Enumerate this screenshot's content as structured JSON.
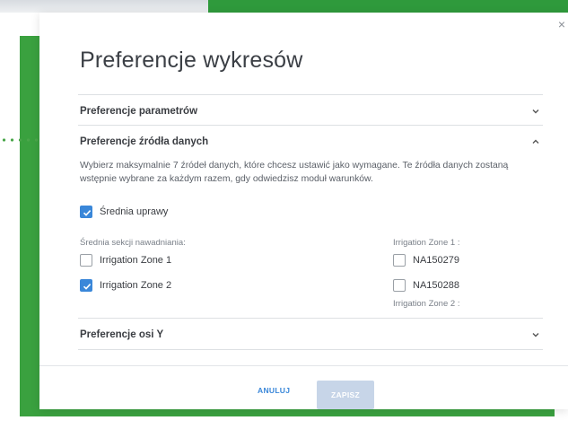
{
  "dialog": {
    "title": "Preferencje wykresów",
    "close_label": "×"
  },
  "sections": [
    {
      "label": "Preferencje parametrów",
      "expanded": false
    },
    {
      "label": "Preferencje źródła danych",
      "expanded": true
    },
    {
      "label": "Preferencje osi Y",
      "expanded": false
    }
  ],
  "data_source": {
    "description": "Wybierz maksymalnie 7 źródeł danych, które chcesz ustawić jako wymagane. Te źródła danych zostaną wstępnie wybrane za każdym razem, gdy odwiedzisz moduł warunków.",
    "crop_average": {
      "label": "Średnia uprawy",
      "checked": true
    },
    "irrigation_avg_heading": "Średnia sekcji nawadniania:",
    "irrigation_avg_items": [
      {
        "label": "Irrigation Zone 1",
        "checked": false
      },
      {
        "label": "Irrigation Zone 2",
        "checked": true
      }
    ],
    "zone1_heading": "Irrigation Zone 1 :",
    "zone1_items": [
      {
        "label": "NA150279",
        "checked": false
      },
      {
        "label": "NA150288",
        "checked": false
      }
    ],
    "zone2_heading": "Irrigation Zone 2 :"
  },
  "footer": {
    "cancel_label": "ANULUJ",
    "save_label": "ZAPISZ",
    "save_enabled": false
  },
  "colors": {
    "accent": "#3a87d9",
    "brand_green": "#3aa13f",
    "disabled_button": "#c7d5e8"
  }
}
